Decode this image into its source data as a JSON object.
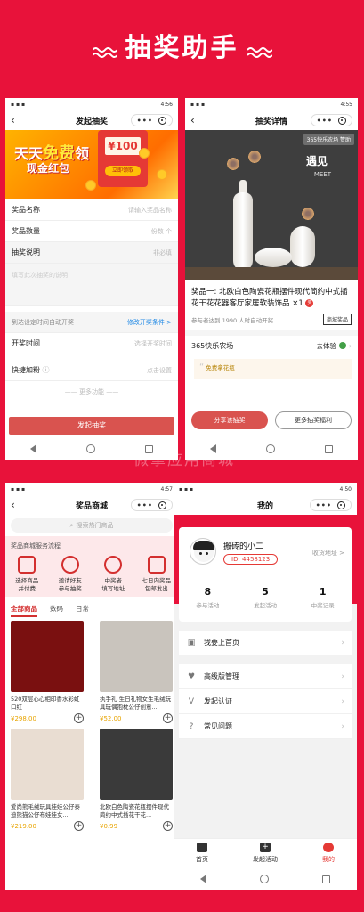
{
  "hero": {
    "title": "抽奖助手"
  },
  "watermark": "微擎应用商城",
  "phone1": {
    "status_time": "4:56",
    "nav_title": "发起抽奖",
    "banner": {
      "line1_a": "天天",
      "line1_hl": "免费",
      "line1_b": "领",
      "line2": "现金红包",
      "amount": "¥100",
      "cta": "立即领取"
    },
    "fields": [
      {
        "label": "奖品名称",
        "placeholder": "请输入奖品名称"
      },
      {
        "label": "奖品数量",
        "placeholder": "份数 个"
      },
      {
        "label": "抽奖说明",
        "placeholder": "非必填"
      }
    ],
    "desc_placeholder": "填写此次抽奖的说明",
    "auto_open": {
      "label": "到达设定时间自动开奖",
      "link": "修改开奖条件 >"
    },
    "open_time": {
      "label": "开奖时间",
      "placeholder": "选择开奖时间"
    },
    "quick_fan": {
      "label": "快捷加粉",
      "placeholder": "点击设置"
    },
    "more": "—— 更多功能 ——",
    "submit": "发起抽奖"
  },
  "phone2": {
    "status_time": "4:55",
    "nav_title": "抽奖详情",
    "sponsor_tag": "365快乐农场 赞助",
    "img_text1": "遇见",
    "img_text2": "MEET",
    "prize_title": "奖品一: 北欧白色陶瓷花瓶摆件现代简约中式插花干花花器客厅家居软装饰品",
    "prize_qty": "×1",
    "prize_badge": "奖",
    "prize_sub": "参与者达到 1990 人时自动开奖",
    "prize_tag": "商城奖品",
    "sponsor": "365快乐农场",
    "go": "去体验",
    "quote": "免费拿花瓶",
    "btn_share": "分享该抽奖",
    "btn_more": "更多抽奖福利"
  },
  "phone3": {
    "status_time": "4:57",
    "nav_title": "奖品商城",
    "search_placeholder": "搜索热门商品",
    "flow_title": "奖品商城服务流程",
    "flow": [
      {
        "icon": "bag-icon",
        "line1": "选择商品",
        "line2": "并付费"
      },
      {
        "icon": "users-icon",
        "line1": "邀请好友",
        "line2": "参与抽奖"
      },
      {
        "icon": "location-icon",
        "line1": "中奖者",
        "line2": "填写地址"
      },
      {
        "icon": "truck-icon",
        "line1": "七日内奖品",
        "line2": "包邮发出"
      }
    ],
    "tabs": [
      "全部商品",
      "数码",
      "日常"
    ],
    "goods": [
      {
        "name": "520双层心心相印香水彩虹口红",
        "price": "¥298.00",
        "color": "#7a1010"
      },
      {
        "name": "执手礼 生日礼物女生毛绒玩具玩偶抱枕公仔创意...",
        "price": "¥52.00",
        "color": "#c9c4bd"
      },
      {
        "name": "爱尚熊毛绒玩具娃娃公仔泰迪熊猫公仔布娃娃女...",
        "price": "¥219.00",
        "color": "#e9ddd2"
      },
      {
        "name": "北欧白色陶瓷花瓶摆件现代简约中式插花干花...",
        "price": "¥0.99",
        "color": "#3a3a3a"
      }
    ]
  },
  "phone4": {
    "status_time": "4:50",
    "nav_title": "我的",
    "username": "搬砖的小二",
    "uid": "ID: 4458123",
    "address": "收货地址 >",
    "stats": [
      {
        "num": "8",
        "label": "参与活动"
      },
      {
        "num": "5",
        "label": "发起活动"
      },
      {
        "num": "1",
        "label": "中奖记录"
      }
    ],
    "menu1": [
      {
        "icon": "bookmark-icon",
        "label": "我要上首页"
      }
    ],
    "menu2": [
      {
        "icon": "diamond-icon",
        "label": "高级版管理"
      },
      {
        "icon": "verify-icon",
        "label": "发起认证"
      },
      {
        "icon": "help-icon",
        "label": "常见问题"
      }
    ],
    "tabs": [
      {
        "icon": "gift-icon",
        "label": "首页"
      },
      {
        "icon": "add-icon",
        "label": "发起活动"
      },
      {
        "icon": "user-icon",
        "label": "我的"
      }
    ]
  },
  "colors": {
    "brand": "#e8123a",
    "button": "#d9534f",
    "price": "#e8a400"
  }
}
